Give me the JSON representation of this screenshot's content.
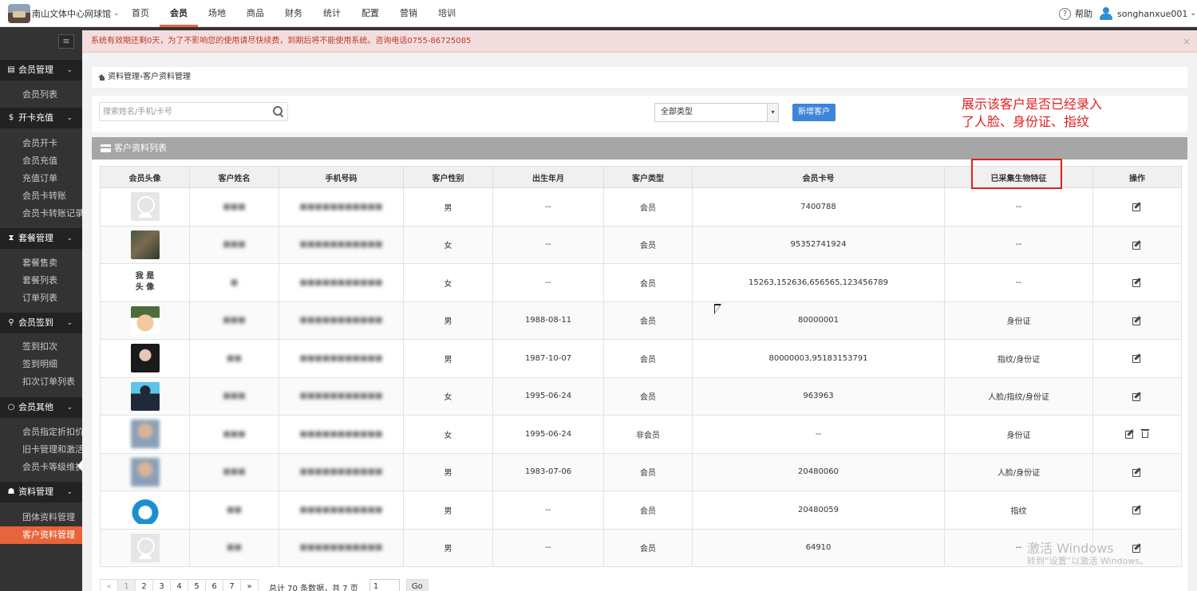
{
  "org": {
    "name": "南山文体中心网球馆",
    "caret": "⌄"
  },
  "nav": [
    "首页",
    "会员",
    "场地",
    "商品",
    "财务",
    "统计",
    "配置",
    "营销",
    "培训"
  ],
  "nav_active_index": 1,
  "header": {
    "help_icon": "?",
    "help": "帮助",
    "username": "songhanxue001",
    "user_caret": "⌄"
  },
  "sidebar": {
    "toggle_icon": "≡",
    "groups": [
      {
        "icon": "▤",
        "label": "会员管理",
        "items": [
          "会员列表"
        ]
      },
      {
        "icon": "$",
        "label": "开卡充值",
        "items": [
          "会员开卡",
          "会员充值",
          "充值订单",
          "会员卡转账",
          "会员卡转账记录"
        ]
      },
      {
        "icon": "⧗",
        "label": "套餐管理",
        "items": [
          "套餐售卖",
          "套餐列表",
          "订单列表"
        ]
      },
      {
        "icon": "⚲",
        "label": "会员签到",
        "items": [
          "签到扣次",
          "签到明细",
          "扣次订单列表"
        ]
      },
      {
        "icon": "○",
        "label": "会员其他",
        "items": [
          "会员指定折扣价",
          "旧卡管理和激活",
          "会员卡等级维护"
        ]
      },
      {
        "icon": "☗",
        "label": "资料管理",
        "items": [
          "团体资料管理",
          "客户资料管理"
        ]
      }
    ],
    "chevron": "⌄",
    "active_item": "客户资料管理"
  },
  "alert": {
    "text": "系统有效期还剩0天，为了不影响您的使用请尽快续费，到期后将不能使用系统。咨询电话0755-86725085",
    "close": "×"
  },
  "breadcrumb": {
    "root": "资料管理",
    "sep": " › ",
    "current": "客户资料管理"
  },
  "toolbar": {
    "search_placeholder": "搜索姓名/手机/卡号",
    "type_select": "全部类型",
    "type_arrow": "▾",
    "add_button": "新增客户"
  },
  "annotation": {
    "text": "展示该客户是否已经录入了人脸、身份证、指纹"
  },
  "panel": {
    "title": "客户资料列表"
  },
  "table": {
    "headers": [
      "会员头像",
      "客户姓名",
      "手机号码",
      "客户性别",
      "出生年月",
      "客户类型",
      "会员卡号",
      "已采集生物特征",
      "操作"
    ],
    "rows": [
      {
        "avatar": "default",
        "avatar_text": "",
        "name": "■■■",
        "phone": "■■■■■■■■■■■",
        "gender": "男",
        "birth": "--",
        "type": "会员",
        "card": "7400788",
        "bio": "--",
        "delete": false
      },
      {
        "avatar": "photo1",
        "avatar_text": "",
        "name": "■■■",
        "phone": "■■■■■■■■■■■",
        "gender": "女",
        "birth": "--",
        "type": "会员",
        "card": "95352741924",
        "bio": "--",
        "delete": false
      },
      {
        "avatar": "text",
        "avatar_text": "我 是 头 像",
        "name": "■",
        "phone": "■■■■■■■■■■■",
        "gender": "女",
        "birth": "--",
        "type": "会员",
        "card": "15263,152636,656565,123456789",
        "bio": "--",
        "delete": false
      },
      {
        "avatar": "cartoon",
        "avatar_text": "",
        "name": "■■■",
        "phone": "■■■■■■■■■■■",
        "gender": "男",
        "birth": "1988-08-11",
        "type": "会员",
        "card": "80000001",
        "bio": "身份证",
        "delete": false
      },
      {
        "avatar": "woman",
        "avatar_text": "",
        "name": "■■",
        "phone": "■■■■■■■■■■■",
        "gender": "男",
        "birth": "1987-10-07",
        "type": "会员",
        "card": "80000003,95183153791",
        "bio": "指纹/身份证",
        "delete": false
      },
      {
        "avatar": "blue",
        "avatar_text": "",
        "name": "■■■",
        "phone": "■■■■■■■■■■■",
        "gender": "女",
        "birth": "1995-06-24",
        "type": "会员",
        "card": "963963",
        "bio": "人脸/指纹/身份证",
        "delete": false
      },
      {
        "avatar": "blur",
        "avatar_text": "",
        "name": "■■■",
        "phone": "■■■■■■■■■■■",
        "gender": "女",
        "birth": "1995-06-24",
        "type": "非会员",
        "card": "--",
        "bio": "身份证",
        "delete": true
      },
      {
        "avatar": "blur",
        "avatar_text": "",
        "name": "■■■",
        "phone": "■■■■■■■■■■■",
        "gender": "男",
        "birth": "1983-07-06",
        "type": "会员",
        "card": "20480060",
        "bio": "人脸/身份证",
        "delete": false
      },
      {
        "avatar": "penguin",
        "avatar_text": "",
        "name": "■■",
        "phone": "■■■■■■■■■■■",
        "gender": "男",
        "birth": "--",
        "type": "会员",
        "card": "20480059",
        "bio": "指纹",
        "delete": false
      },
      {
        "avatar": "default",
        "avatar_text": "",
        "name": "■■",
        "phone": "■■■■■■■■■■■",
        "gender": "男",
        "birth": "--",
        "type": "会员",
        "card": "64910",
        "bio": "--",
        "delete": false
      }
    ]
  },
  "pagination": {
    "prev": "«",
    "pages": [
      "1",
      "2",
      "3",
      "4",
      "5",
      "6",
      "7"
    ],
    "next": "»",
    "current": "1",
    "summary": "总计 70 条数据，共 7 页",
    "input_value": "1",
    "go": "Go"
  },
  "watermark": {
    "line1": "激活 Windows",
    "line2": "转到“设置”以激活 Windows。"
  }
}
